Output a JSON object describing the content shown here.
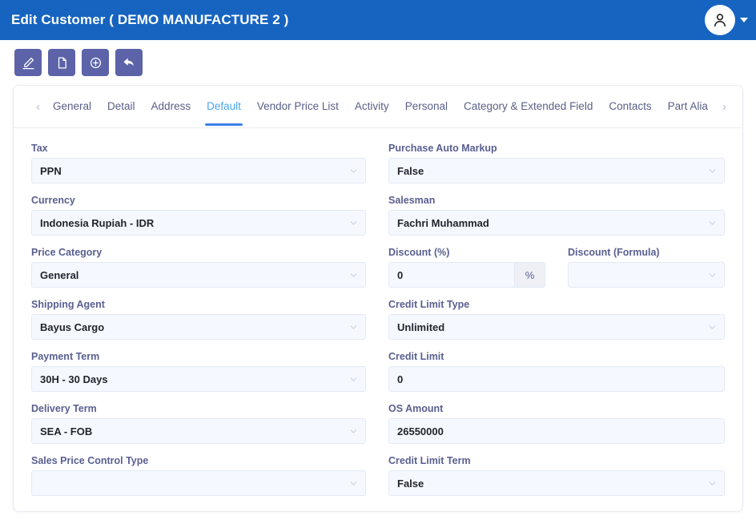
{
  "titlebar": {
    "title": "Edit Customer ( DEMO MANUFACTURE 2 )",
    "avatar_icon": "user-icon",
    "caret_icon": "caret-down-icon",
    "bg_color": "#1664c0"
  },
  "toolbar": {
    "buttons": [
      {
        "name": "edit-button",
        "icon": "pencil-icon"
      },
      {
        "name": "duplicate-button",
        "icon": "copy-icon"
      },
      {
        "name": "add-button",
        "icon": "plus-circle-icon"
      },
      {
        "name": "back-button",
        "icon": "back-arrow-icon"
      }
    ],
    "bg_color": "#5c63a8"
  },
  "tabs": {
    "prev_arrow": "‹",
    "next_arrow": "›",
    "active": "Default",
    "active_color": "#4aa5f0",
    "underline_color": "#3b82e8",
    "items": [
      {
        "label": "General",
        "active": false
      },
      {
        "label": "Detail",
        "active": false
      },
      {
        "label": "Address",
        "active": false
      },
      {
        "label": "Default",
        "active": true
      },
      {
        "label": "Vendor Price List",
        "active": false
      },
      {
        "label": "Activity",
        "active": false
      },
      {
        "label": "Personal",
        "active": false
      },
      {
        "label": "Category & Extended Field",
        "active": false
      },
      {
        "label": "Contacts",
        "active": false
      },
      {
        "label": "Part Alia",
        "active": false
      }
    ]
  },
  "form": {
    "left": [
      {
        "label": "Tax",
        "value": "PPN",
        "type": "select"
      },
      {
        "label": "Currency",
        "value": "Indonesia Rupiah - IDR",
        "type": "select"
      },
      {
        "label": "Price Category",
        "value": "General",
        "type": "select"
      },
      {
        "label": "Shipping Agent",
        "value": "Bayus Cargo",
        "type": "select"
      },
      {
        "label": "Payment Term",
        "value": "30H - 30 Days",
        "type": "select"
      },
      {
        "label": "Delivery Term",
        "value": "SEA - FOB",
        "type": "select"
      },
      {
        "label": "Sales Price Control Type",
        "value": "",
        "type": "select"
      }
    ],
    "right": [
      {
        "label": "Purchase Auto Markup",
        "value": "False",
        "type": "select"
      },
      {
        "label": "Salesman",
        "value": "Fachri Muhammad",
        "type": "select"
      }
    ],
    "discount_row": {
      "percent": {
        "label": "Discount (%)",
        "value": "0",
        "type": "text",
        "addon": "%"
      },
      "formula": {
        "label": "Discount (Formula)",
        "value": "",
        "type": "select"
      }
    },
    "right_lower": [
      {
        "label": "Credit Limit Type",
        "value": "Unlimited",
        "type": "select"
      },
      {
        "label": "Credit Limit",
        "value": "0",
        "type": "text"
      },
      {
        "label": "OS Amount",
        "value": "26550000",
        "type": "text"
      },
      {
        "label": "Credit Limit Term",
        "value": "False",
        "type": "select"
      }
    ]
  }
}
